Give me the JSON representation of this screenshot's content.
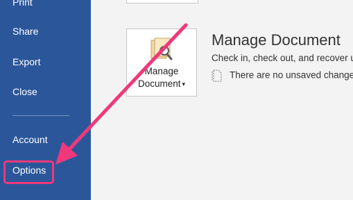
{
  "sidebar": {
    "items": [
      {
        "label": "Print"
      },
      {
        "label": "Share"
      },
      {
        "label": "Export"
      },
      {
        "label": "Close"
      },
      {
        "label": "Account"
      },
      {
        "label": "Options"
      }
    ]
  },
  "main": {
    "manage_document": {
      "button_line1": "Manage",
      "button_line2": "Document",
      "caret": "▾",
      "title": "Manage Document",
      "description": "Check in, check out, and recover u",
      "status": "There are no unsaved change"
    }
  },
  "colors": {
    "sidebar": "#2b579a",
    "background": "#f3f3f3",
    "annotation": "#f0387a"
  },
  "icons": [
    "folder-magnifier-icon",
    "document-icon",
    "caret-down-icon"
  ]
}
